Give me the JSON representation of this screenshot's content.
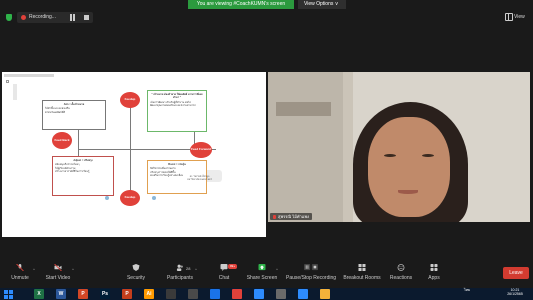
{
  "banner": {
    "status_text": "You are viewing #CoachKUMN's screen",
    "view_options_label": "View Options",
    "view_options_chevron": "v"
  },
  "top_bar": {
    "recording_label": "Recording...",
    "view_label": "View"
  },
  "slide": {
    "top_text": "\" เป้าหมาย ต้องท้าทาย ให้ผลลัพธ์ มากกว่าที่เคยทำมา \"",
    "top_bullets": [
      "เน้นการพัฒนา สำหรับผู้ที่ทำงาน ต่อไป",
      "พัฒนาคุณภาพของทักษะและความสามารถ"
    ],
    "left_top_header": "Aim = ตั้งเป้าหมาย",
    "left_top_bullets": [
      "ให้คำชี้แนะและส่งเสริม",
      "คาดหวังผลลัพธ์ที่ดี"
    ],
    "left_bottom_header": "Adjust = ปรับปรุง",
    "left_bottom_bullets": [
      "สนับสนุนกิจกรรมใหม่ๆ",
      "ให้ผู้เรียนมีส่วนร่วม",
      "สร้างบรรยากาศที่ดีในการเรียนรู้"
    ],
    "right_bottom_header": "Boost = กระตุ้น",
    "right_bottom_bullets": [
      "จัดกิจกรรมที่หลากหลาย",
      "ปรับปรุงการสอนให้ดีขึ้น",
      "ส่งเสริมการเรียนรู้อย่างต่อเนื่อง"
    ],
    "bursts": {
      "top": "Feedup",
      "left": "Feed Back",
      "right": "Feed Forward",
      "bottom": "Feedup"
    },
    "credit_line1": "ดร. ไพรวัลย์ เพ็ชรพูล",
    "credit_line2": "มหาวิทยาลัยเกษตรศาสตร์"
  },
  "video": {
    "participant_name": "สุพรรณิ ไม้คำแพง"
  },
  "toolbar": {
    "unmute": "Unmute",
    "start_video": "Start Video",
    "security": "Security",
    "participants": "Participants",
    "participant_count": "28",
    "chat": "Chat",
    "chat_badge": "99+",
    "share_screen": "Share Screen",
    "pause_recording": "Pause/Stop Recording",
    "breakout": "Breakout Rooms",
    "reactions": "Reactions",
    "apps": "Apps",
    "leave": "Leave"
  },
  "taskbar": {
    "time": "10:21",
    "date": "26/1/2565",
    "lang": "ไทย",
    "apps": [
      {
        "name": "excel-app-icon",
        "glyph": "X",
        "color": "#1e7145"
      },
      {
        "name": "word-app-icon",
        "glyph": "W",
        "color": "#2b579a"
      },
      {
        "name": "powerpoint-app-icon",
        "glyph": "P",
        "color": "#d24726"
      },
      {
        "name": "photoshop-app-icon",
        "glyph": "Ps",
        "color": "#001e36"
      },
      {
        "name": "powerpoint2-app-icon",
        "glyph": "P",
        "color": "#c43e1c"
      },
      {
        "name": "illustrator-app-icon",
        "glyph": "Ai",
        "color": "#ff9a00"
      },
      {
        "name": "app-7-icon",
        "glyph": "",
        "color": "#3a3a3a"
      },
      {
        "name": "app-8-icon",
        "glyph": "",
        "color": "#4a4a4a"
      },
      {
        "name": "app-9-icon",
        "glyph": "",
        "color": "#1a73e8"
      },
      {
        "name": "app-10-icon",
        "glyph": "",
        "color": "#e0413a"
      },
      {
        "name": "app-11-icon",
        "glyph": "",
        "color": "#2d8cff"
      },
      {
        "name": "app-12-icon",
        "glyph": "",
        "color": "#6a6a6a"
      },
      {
        "name": "app-13-icon",
        "glyph": "",
        "color": "#2d8cff"
      },
      {
        "name": "app-14-icon",
        "glyph": "",
        "color": "#f3b13a"
      }
    ]
  }
}
